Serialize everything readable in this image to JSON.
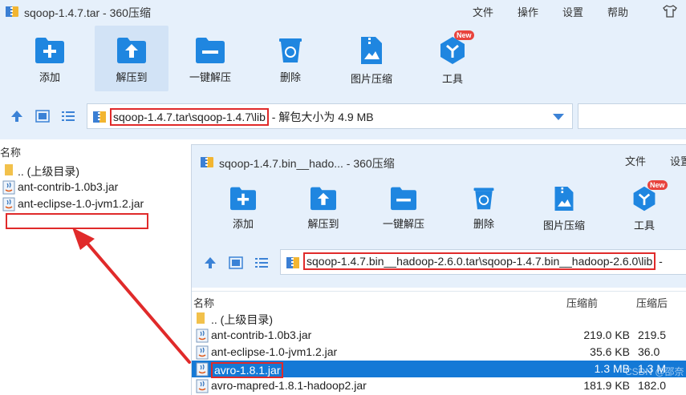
{
  "window1": {
    "title": "sqoop-1.4.7.tar - 360压缩",
    "menu": [
      "文件",
      "操作",
      "设置",
      "帮助"
    ],
    "toolbar": [
      {
        "label": "添加",
        "icon": "add-icon"
      },
      {
        "label": "解压到",
        "icon": "extract-to-icon",
        "active": true
      },
      {
        "label": "一键解压",
        "icon": "one-click-extract-icon"
      },
      {
        "label": "删除",
        "icon": "delete-icon"
      },
      {
        "label": "图片压缩",
        "icon": "image-compress-icon"
      },
      {
        "label": "工具",
        "icon": "tools-icon",
        "badge": "New"
      }
    ],
    "path": "sqoop-1.4.7.tar\\sqoop-1.4.7\\lib",
    "path_suffix": " - 解包大小为 4.9 MB",
    "column_name": "名称",
    "files": [
      {
        "name": ".. (上级目录)",
        "type": "folder"
      },
      {
        "name": "ant-contrib-1.0b3.jar",
        "type": "jar"
      },
      {
        "name": "ant-eclipse-1.0-jvm1.2.jar",
        "type": "jar"
      }
    ]
  },
  "window2": {
    "title": "sqoop-1.4.7.bin__hado... - 360压缩",
    "menu": [
      "文件",
      "设置"
    ],
    "toolbar": [
      {
        "label": "添加",
        "icon": "add-icon"
      },
      {
        "label": "解压到",
        "icon": "extract-to-icon"
      },
      {
        "label": "一键解压",
        "icon": "one-click-extract-icon"
      },
      {
        "label": "删除",
        "icon": "delete-icon"
      },
      {
        "label": "图片压缩",
        "icon": "image-compress-icon"
      },
      {
        "label": "工具",
        "icon": "tools-icon",
        "badge": "New"
      }
    ],
    "path": "sqoop-1.4.7.bin__hadoop-2.6.0.tar\\sqoop-1.4.7.bin__hadoop-2.6.0\\lib",
    "path_suffix": " - ",
    "columns": {
      "name": "名称",
      "size": "压缩前",
      "packed": "压缩后"
    },
    "files": [
      {
        "name": ".. (上级目录)",
        "type": "folder",
        "size": "",
        "packed": ""
      },
      {
        "name": "ant-contrib-1.0b3.jar",
        "type": "jar",
        "size": "219.0 KB",
        "packed": "219.5"
      },
      {
        "name": "ant-eclipse-1.0-jvm1.2.jar",
        "type": "jar",
        "size": "35.6 KB",
        "packed": "36.0"
      },
      {
        "name": "avro-1.8.1.jar",
        "type": "jar",
        "size": "1.3 MB",
        "packed": "1.3 M",
        "selected": true
      },
      {
        "name": "avro-mapred-1.8.1-hadoop2.jar",
        "type": "jar",
        "size": "181.9 KB",
        "packed": "182.0"
      }
    ],
    "watermark": "CSDN @邵奈一"
  },
  "colors": {
    "titlebar_bg": "#e6f0fb",
    "accent_blue": "#1479d6",
    "highlight_red": "#e02a2a",
    "badge_red": "#e8433d"
  }
}
